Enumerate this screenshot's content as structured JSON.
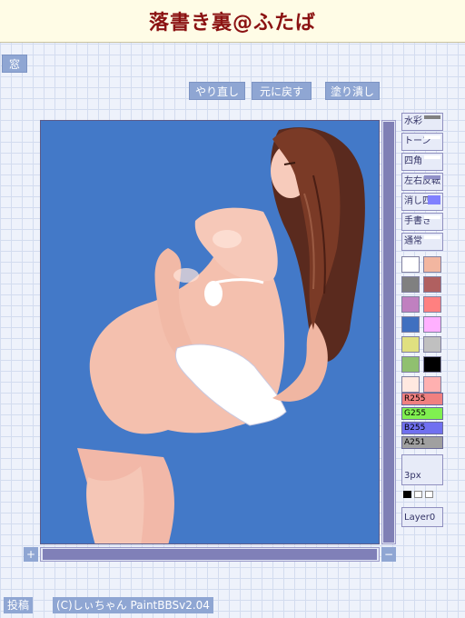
{
  "header": {
    "title": "落書き裏@ふたば"
  },
  "window_button": "窓",
  "toolbar": {
    "redo": "やり直し",
    "undo": "元に戻す",
    "fill": "塗り潰し"
  },
  "tools": {
    "watercolor": "水彩",
    "tone": "トーン",
    "rect": "四角",
    "flip": "左右反転",
    "erase_rect": "消し四角",
    "handwrite": "手書き",
    "normal": "通常"
  },
  "palette": [
    "#ffffff",
    "#f2b6a0",
    "#808080",
    "#b06060",
    "#c080c0",
    "#ff8080",
    "#4070c0",
    "#ffb0ff",
    "#e0e080",
    "#c0c0c0",
    "#90c070",
    "#000000",
    "#ffe8e0",
    "#ffb0b0"
  ],
  "sliders": {
    "r": "R255",
    "g": "G255",
    "b": "B255",
    "a": "A251"
  },
  "slider_colors": {
    "r": "#f08080",
    "g": "#80f050",
    "b": "#7070f0",
    "a": "#a0a0a0"
  },
  "pen_size": "3px",
  "layer_label": "Layer0",
  "scroll": {
    "plus": "+",
    "minus": "−"
  },
  "footer": {
    "post_button": "投稿",
    "credit": "(C)しぃちゃん PaintBBSv2.04"
  }
}
